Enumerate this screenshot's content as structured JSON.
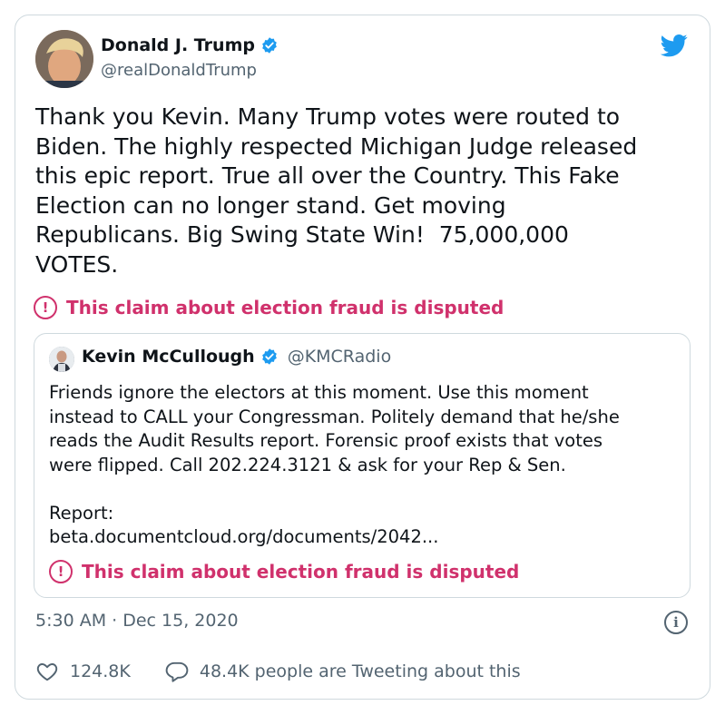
{
  "author": {
    "name": "Donald J. Trump",
    "handle": "@realDonaldTrump"
  },
  "tweet": {
    "text": "Thank you Kevin. Many Trump votes were routed to\nBiden. The highly respected Michigan Judge released\nthis epic report. True all over the Country. This Fake\nElection can no longer stand. Get moving\nRepublicans. Big Swing State Win!  75,000,000\nVOTES.",
    "label": "This claim about election fraud is disputed"
  },
  "quote": {
    "name": "Kevin McCullough",
    "handle": "@KMCRadio",
    "text": "Friends ignore the electors at this moment. Use this moment\ninstead to CALL your Congressman. Politely demand that he/she\nreads the Audit Results report. Forensic proof exists that votes\nwere flipped. Call 202.224.3121 & ask for your Rep & Sen.\n\nReport:\nbeta.documentcloud.org/documents/2042...",
    "label": "This claim about election fraud is disputed"
  },
  "footer": {
    "timestamp": "5:30 AM · Dec 15, 2020",
    "likes": "124.8K",
    "replies": "48.4K people are Tweeting about this"
  },
  "icons": {
    "verified": "verified-badge-icon",
    "bird": "twitter-bird-icon",
    "warning": "exclamation-circle-icon",
    "info": "info-icon",
    "like": "heart-icon",
    "reply": "speech-bubble-icon"
  },
  "colors": {
    "brand": "#1d9bf0",
    "disputed": "#d0316c",
    "muted": "#536471",
    "border": "#cfd9de"
  }
}
